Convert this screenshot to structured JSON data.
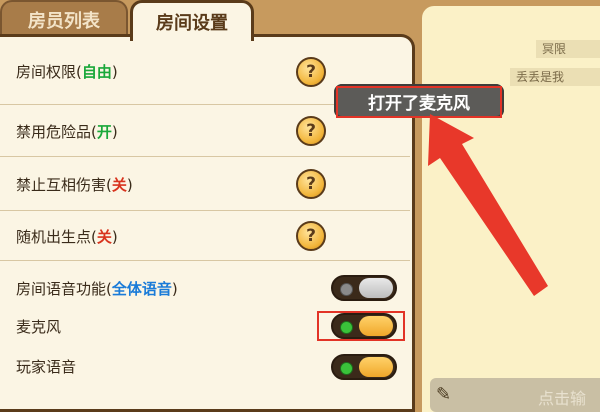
{
  "tabs": [
    {
      "label": "房员列表"
    },
    {
      "label": "房间设置"
    }
  ],
  "settings": {
    "room_permission": {
      "label": "房间权限(",
      "status": "自由",
      "close": ")"
    },
    "ban_dangerous": {
      "label": "禁用危险品(",
      "status": "开",
      "close": ")"
    },
    "no_mutual_damage": {
      "label": "禁止互相伤害(",
      "status": "关",
      "close": ")"
    },
    "random_spawn": {
      "label": "随机出生点(",
      "status": "关",
      "close": ")"
    },
    "room_voice": {
      "label": "房间语音功能(",
      "status": "全体语音",
      "close": ")",
      "toggle": "off"
    },
    "microphone": {
      "label": "麦克风",
      "toggle": "on"
    },
    "player_voice": {
      "label": "玩家语音",
      "toggle": "on"
    }
  },
  "help_glyph": "?",
  "tooltip": "打开了麦克风",
  "chat": {
    "lines": [
      "冥限",
      "丢丢是我"
    ],
    "input_hint": "点击输"
  },
  "colors": {
    "status_green": "#1aa83a",
    "status_red": "#d8341e",
    "status_blue": "#1a7bd8",
    "annotation_red": "#e23326"
  },
  "icons": {
    "help": "question-icon",
    "pencil": "pencil-icon"
  }
}
